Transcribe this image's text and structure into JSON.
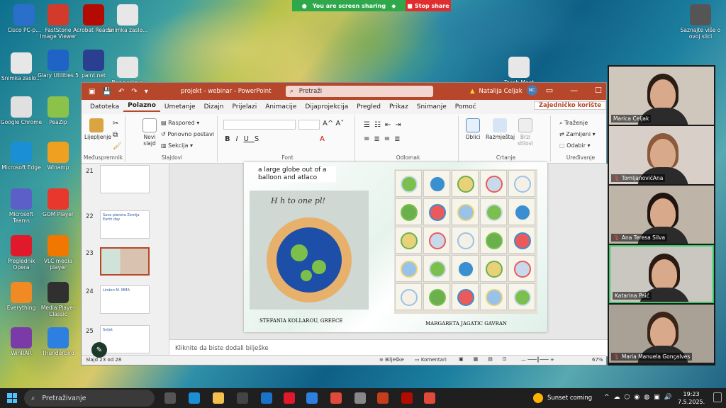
{
  "zoom_bar": {
    "status": "You are screen sharing",
    "stop": "Stop share"
  },
  "desktop_icons": [
    {
      "label": "Cisco PC-p...",
      "color": "#2a6fc9"
    },
    {
      "label": "FastStone Image Viewer",
      "color": "#d23b2b"
    },
    {
      "label": "Acrobat Reader",
      "color": "#b30b00"
    },
    {
      "label": "Snimka zaslo...",
      "color": "#e7e7e7"
    },
    {
      "label": "Snimka zaslo...",
      "color": "#e7e7e7"
    },
    {
      "label": "Glary Utilities 5",
      "color": "#1f63c7"
    },
    {
      "label": "paint.net",
      "color": "#2a3f8f"
    },
    {
      "label": "Bez naslova",
      "color": "#e7e7e7"
    },
    {
      "label": "Google Chrome",
      "color": "#e0e0e0"
    },
    {
      "label": "PeaZip",
      "color": "#8bc34a"
    },
    {
      "label": "Microsoft Edge",
      "color": "#1b8fd6"
    },
    {
      "label": "Winamp",
      "color": "#f0a020"
    },
    {
      "label": "Microsoft Teams",
      "color": "#5b5fc7"
    },
    {
      "label": "GOM Player",
      "color": "#e8372c"
    },
    {
      "label": "Preglednik Opera",
      "color": "#e01a2b"
    },
    {
      "label": "VLC media player",
      "color": "#f07800"
    },
    {
      "label": "Everything",
      "color": "#f08a24"
    },
    {
      "label": "Media Player Classic",
      "color": "#303030"
    },
    {
      "label": "WinRAR",
      "color": "#7a3aa8"
    },
    {
      "label": "Thunderbird",
      "color": "#2d7fe0"
    },
    {
      "label": "Teach Meet",
      "color": "#e7e7e7"
    },
    {
      "label": "Saznajte više o ovoj slici",
      "color": "#555"
    }
  ],
  "ppt": {
    "title": "projekt - webinar - PowerPoint",
    "search": "Pretraži",
    "user": "Natalija Celjak",
    "initials": "NC",
    "tabs": [
      "Datoteka",
      "Polazno",
      "Umetanje",
      "Dizajn",
      "Prijelazi",
      "Animacije",
      "Dijaprojekcija",
      "Pregled",
      "Prikaz",
      "Snimanje",
      "Pomoć"
    ],
    "share": "Zajedničko korište",
    "ribbon": {
      "paste": "Lijepljenje",
      "clipboard": "Međuspremnik",
      "new_slide": "Novi slajd",
      "layout": "Raspored",
      "reset": "Ponovno postavi",
      "section": "Sekcija",
      "slides": "Slajdovi",
      "font": "Font",
      "paragraph": "Odlomak",
      "shapes": "Oblici",
      "arrange": "Razmještaj",
      "quick_styles": "Brzi stilovi",
      "drawing": "Crtanje",
      "find": "Traženje",
      "replace": "Zamijeni",
      "select": "Odabir",
      "editing": "Uređivanje"
    },
    "thumbs": [
      {
        "num": "21",
        "title": ""
      },
      {
        "num": "22",
        "title": "Save planeta Zemlja Earth day"
      },
      {
        "num": "23",
        "title": ""
      },
      {
        "num": "24",
        "title": "Lindon M. MMA"
      },
      {
        "num": "25",
        "title": "Svijet"
      }
    ],
    "slide": {
      "caption": "a large globe out of a balloon and atlaco",
      "left_credit": "STEFANIA KOLLAROU, GREECE",
      "right_credit": "MARGARETA JAGATIC GAVRAN"
    },
    "notes": "Kliknite da biste dodali bilješke",
    "status": {
      "slide": "Slajd 23 od 28",
      "notes": "Bilješke",
      "comments": "Komentari",
      "zoom": "67%"
    }
  },
  "participants": [
    {
      "name": "Marica Celjak",
      "muted": false
    },
    {
      "name": "TomljanovićAna",
      "muted": true
    },
    {
      "name": "Ana Teresa Silva",
      "muted": true
    },
    {
      "name": "Katarina Paić",
      "muted": false
    },
    {
      "name": "Maria Manuela Gonçalves",
      "muted": true
    }
  ],
  "taskbar": {
    "search": "Pretraživanje",
    "weather": "Sunset coming",
    "time": "19:23",
    "date": "7.5.2025."
  }
}
